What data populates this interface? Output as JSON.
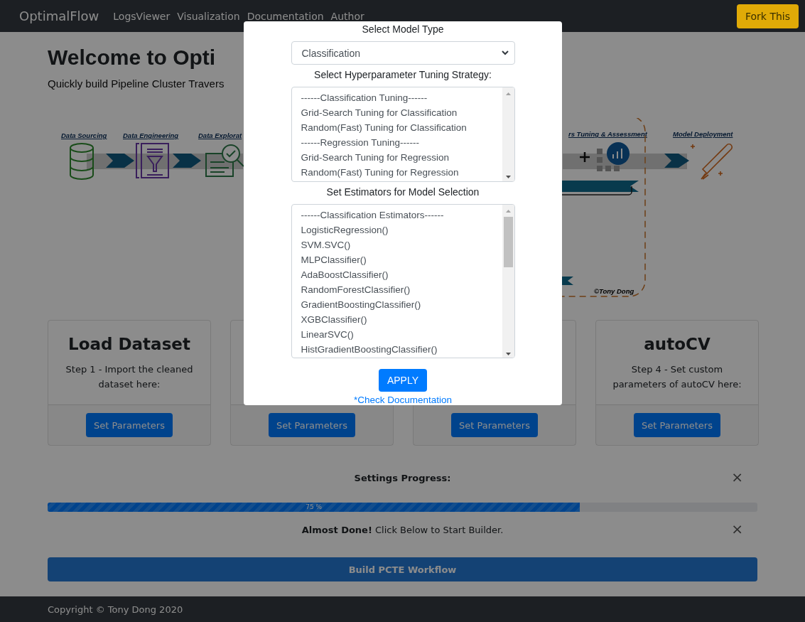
{
  "navbar": {
    "brand": "OptimalFlow",
    "links": [
      "LogsViewer",
      "Visualization",
      "Documentation",
      "Author"
    ],
    "action": "Fork This"
  },
  "hero": {
    "title": "Welcome to Opti",
    "subtitle": "Quickly build Pipeline Cluster Travers"
  },
  "diagram": {
    "labels": [
      "Data Sourcing",
      "Data Engineering",
      "Data Explorat",
      "rs Tuning & Assessment",
      "Model Deployment"
    ],
    "credit": "©Tony Dong"
  },
  "cards": [
    {
      "title": "Load Dataset",
      "text": "Step 1 - Import the cleaned dataset here:",
      "button": "Set Parameters"
    },
    {
      "button": "Set Parameters"
    },
    {
      "button": "Set Parameters"
    },
    {
      "title": "autoCV",
      "text": "Step 4 - Set custom parameters of autoCV here:",
      "button": "Set Parameters"
    }
  ],
  "progress": {
    "heading": "Settings Progress:",
    "close": "×",
    "level": 0.75,
    "reading": "75 %"
  },
  "alert": {
    "message": "**Almost Done!** Click Below to Start Builder.",
    "close": "×"
  },
  "build_button": {
    "label": "Build PCTE Workflow",
    "disabled": true
  },
  "footer": "Copyright © Tony Dong 2020",
  "modal": {
    "model_type_label": "Select Model Type",
    "model_type": "Classification",
    "tuning_label": "Select Hyperparameter Tuning Strategy:",
    "tuning_options": [
      "------Classification Tuning------",
      "Grid-Search Tuning for Classification",
      "Random(Fast) Tuning for Classification",
      "------Regression Tuning------",
      "Grid-Search Tuning for Regression",
      "Random(Fast) Tuning for Regression"
    ],
    "estimators_label": "Set Estimators for Model Selection",
    "estimator_options": [
      "------Classification Estimators------",
      "LogisticRegression()",
      "SVM.SVC()",
      "MLPClassifier()",
      "AdaBoostClassifier()",
      "RandomForestClassifier()",
      "GradientBoostingClassifier()",
      "XGBClassifier()",
      "LinearSVC()",
      "HistGradientBoostingClassifier()"
    ],
    "apply": "APPLY",
    "doc_link": "*Check Documentation"
  }
}
